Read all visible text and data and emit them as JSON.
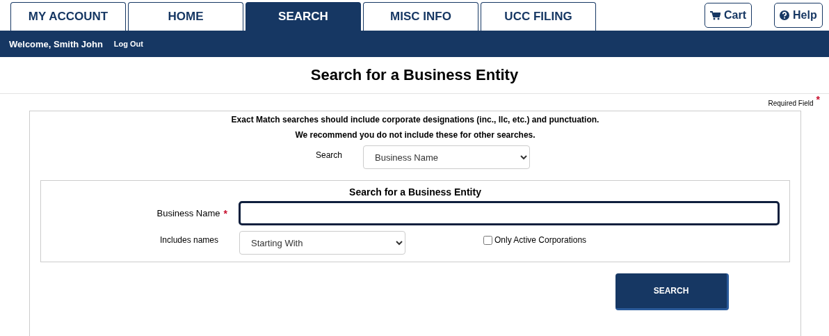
{
  "tabs": [
    {
      "label": "MY ACCOUNT",
      "selected": false
    },
    {
      "label": "HOME",
      "selected": false
    },
    {
      "label": "SEARCH",
      "selected": true
    },
    {
      "label": "MISC INFO",
      "selected": false
    },
    {
      "label": "UCC FILING",
      "selected": false
    }
  ],
  "header_buttons": [
    {
      "kind": "cart",
      "label": "Cart"
    },
    {
      "kind": "help",
      "label": "Help"
    }
  ],
  "user_bar": {
    "welcome": "Welcome, Smith John",
    "logout": "Log Out"
  },
  "page_title": "Search for a Business Entity",
  "required_note": {
    "label": "Required Field",
    "mark": "*"
  },
  "form": {
    "notes": [
      "Exact Match searches should include corporate designations (inc., llc, etc.) and punctuation.",
      "We recommend you do not include these for other searches."
    ],
    "search_type": {
      "label": "Search",
      "value": "Business Name"
    },
    "panel": {
      "title": "Search for a Business Entity",
      "business_name": {
        "label": "Business Name",
        "required": true
      },
      "includes": {
        "label": "Includes names",
        "value": "Starting With"
      },
      "active_only": {
        "label": "Only Active Corporations",
        "checked": false
      }
    },
    "submit": "SEARCH"
  }
}
